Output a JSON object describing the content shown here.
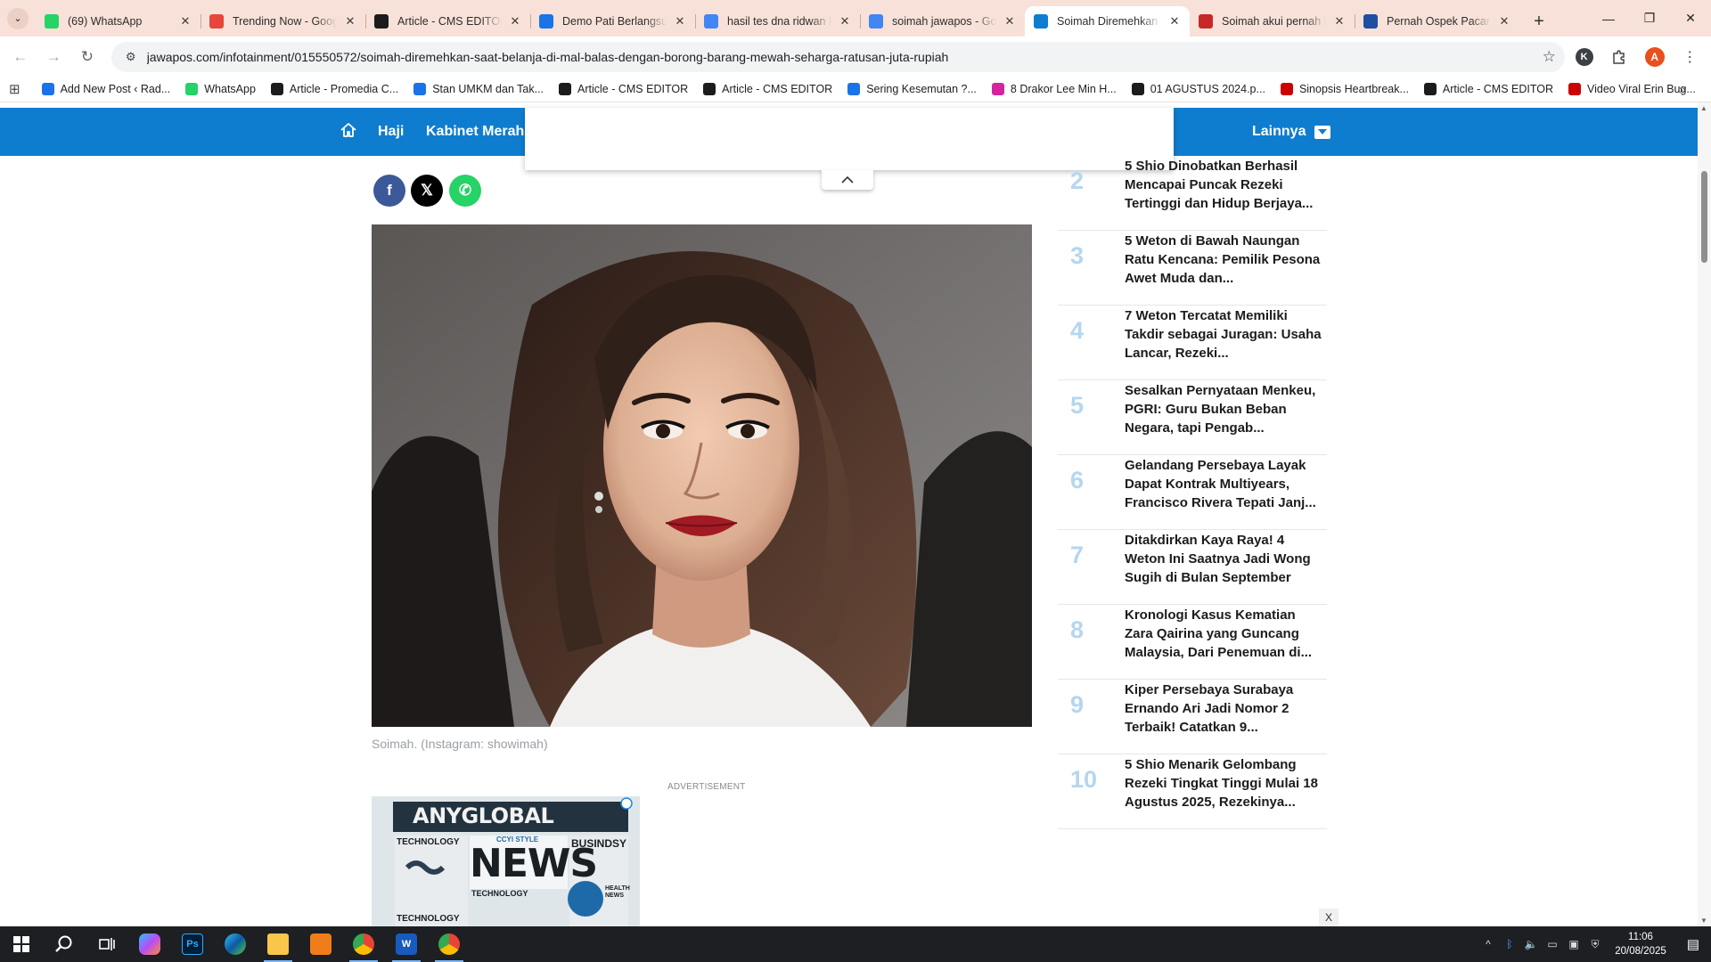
{
  "tabs": [
    {
      "title": "(69) WhatsApp",
      "icon": "whatsapp-icon",
      "color": "#25d366",
      "active": false
    },
    {
      "title": "Trending Now - Goog",
      "icon": "trends-icon",
      "color": "#e8453c",
      "active": false
    },
    {
      "title": "Article - CMS EDITOR",
      "icon": "cms-icon",
      "color": "#1c1c1c",
      "active": false
    },
    {
      "title": "Demo Pati Berlangsun",
      "icon": "bookmark-icon",
      "color": "#1a73e8",
      "active": false
    },
    {
      "title": "hasil tes dna ridwan k",
      "icon": "google-icon",
      "color": "#4285f4",
      "active": false
    },
    {
      "title": "soimah jawapos - Goo",
      "icon": "google-icon",
      "color": "#4285f4",
      "active": false
    },
    {
      "title": "Soimah Diremehkan Sa",
      "icon": "jawapos-icon",
      "color": "#0f7dcf",
      "active": true
    },
    {
      "title": "Soimah akui pernah ta",
      "icon": "news-icon",
      "color": "#c62828",
      "active": false
    },
    {
      "title": "Pernah Ospek Pacar A",
      "icon": "news-icon",
      "color": "#1e4fa3",
      "active": false
    }
  ],
  "address": {
    "url": "jawapos.com/infotainment/015550572/soimah-diremehkan-saat-belanja-di-mal-balas-dengan-borong-barang-mewah-seharga-ratusan-juta-rupiah",
    "profile_k": "K",
    "profile_a": "A"
  },
  "bookmarks": [
    {
      "label": "Add New Post ‹ Rad...",
      "color": "#1a73e8"
    },
    {
      "label": "WhatsApp",
      "color": "#25d366"
    },
    {
      "label": "Article - Promedia C...",
      "color": "#1c1c1c"
    },
    {
      "label": "Stan UMKM dan Tak...",
      "color": "#1a73e8"
    },
    {
      "label": "Article - CMS EDITOR",
      "color": "#1c1c1c"
    },
    {
      "label": "Article - CMS EDITOR",
      "color": "#1c1c1c"
    },
    {
      "label": "Sering Kesemutan ?...",
      "color": "#1a73e8"
    },
    {
      "label": "8 Drakor Lee Min H...",
      "color": "#d6249f"
    },
    {
      "label": "01 AGUSTUS 2024.p...",
      "color": "#1c1c1c"
    },
    {
      "label": "Sinopsis Heartbreak...",
      "color": "#cc0000"
    },
    {
      "label": "Article - CMS EDITOR",
      "color": "#1c1c1c"
    },
    {
      "label": "Video Viral Erin Bug...",
      "color": "#cc0000"
    }
  ],
  "site_nav": {
    "links": [
      "Haji",
      "Kabinet Merah P"
    ],
    "more_label": "Lainnya",
    "brand_color": "#0f7dcf"
  },
  "share": [
    {
      "name": "facebook",
      "glyph": "f",
      "color": "#3b5998"
    },
    {
      "name": "x",
      "glyph": "𝕏",
      "color": "#000000"
    },
    {
      "name": "whatsapp",
      "glyph": "✆",
      "color": "#25d366"
    }
  ],
  "article": {
    "caption": "Soimah. (Instagram: showimah)",
    "ad_label": "ADVERTISEMENT"
  },
  "ad_banner": {
    "headline_top": "ANYGLOBAL",
    "headline_main": "NEWS",
    "tag1": "TECHNOLOGY",
    "tag2": "BUSINDSY",
    "tag3": "TECHNOLOGY",
    "tag4": "HEALTH NEWS",
    "tag5": "TECHNOLOGY",
    "ribbon": "CCYI STYLE"
  },
  "trending": [
    {
      "rank": "2",
      "title": "5 Shio Dinobatkan Berhasil Mencapai Puncak Rezeki Tertinggi dan Hidup Berjaya..."
    },
    {
      "rank": "3",
      "title": "5 Weton di Bawah Naungan Ratu Kencana: Pemilik Pesona Awet Muda dan..."
    },
    {
      "rank": "4",
      "title": "7 Weton Tercatat Memiliki Takdir sebagai Juragan: Usaha Lancar, Rezeki..."
    },
    {
      "rank": "5",
      "title": "Sesalkan Pernyataan Menkeu, PGRI: Guru Bukan Beban Negara, tapi Pengab..."
    },
    {
      "rank": "6",
      "title": "Gelandang Persebaya Layak Dapat Kontrak Multiyears, Francisco Rivera Tepati Janj..."
    },
    {
      "rank": "7",
      "title": "Ditakdirkan Kaya Raya! 4 Weton Ini Saatnya Jadi Wong Sugih di Bulan September"
    },
    {
      "rank": "8",
      "title": "Kronologi Kasus Kematian Zara Qairina yang Guncang Malaysia, Dari Penemuan di..."
    },
    {
      "rank": "9",
      "title": "Kiper Persebaya Surabaya Ernando Ari Jadi Nomor 2 Terbaik! Catatkan 9..."
    },
    {
      "rank": "10",
      "title": "5 Shio Menarik Gelombang Rezeki Tingkat Tinggi Mulai 18 Agustus 2025, Rezekinya..."
    }
  ],
  "close_label": "X",
  "taskbar": {
    "time": "11:06",
    "date": "20/08/2025"
  }
}
